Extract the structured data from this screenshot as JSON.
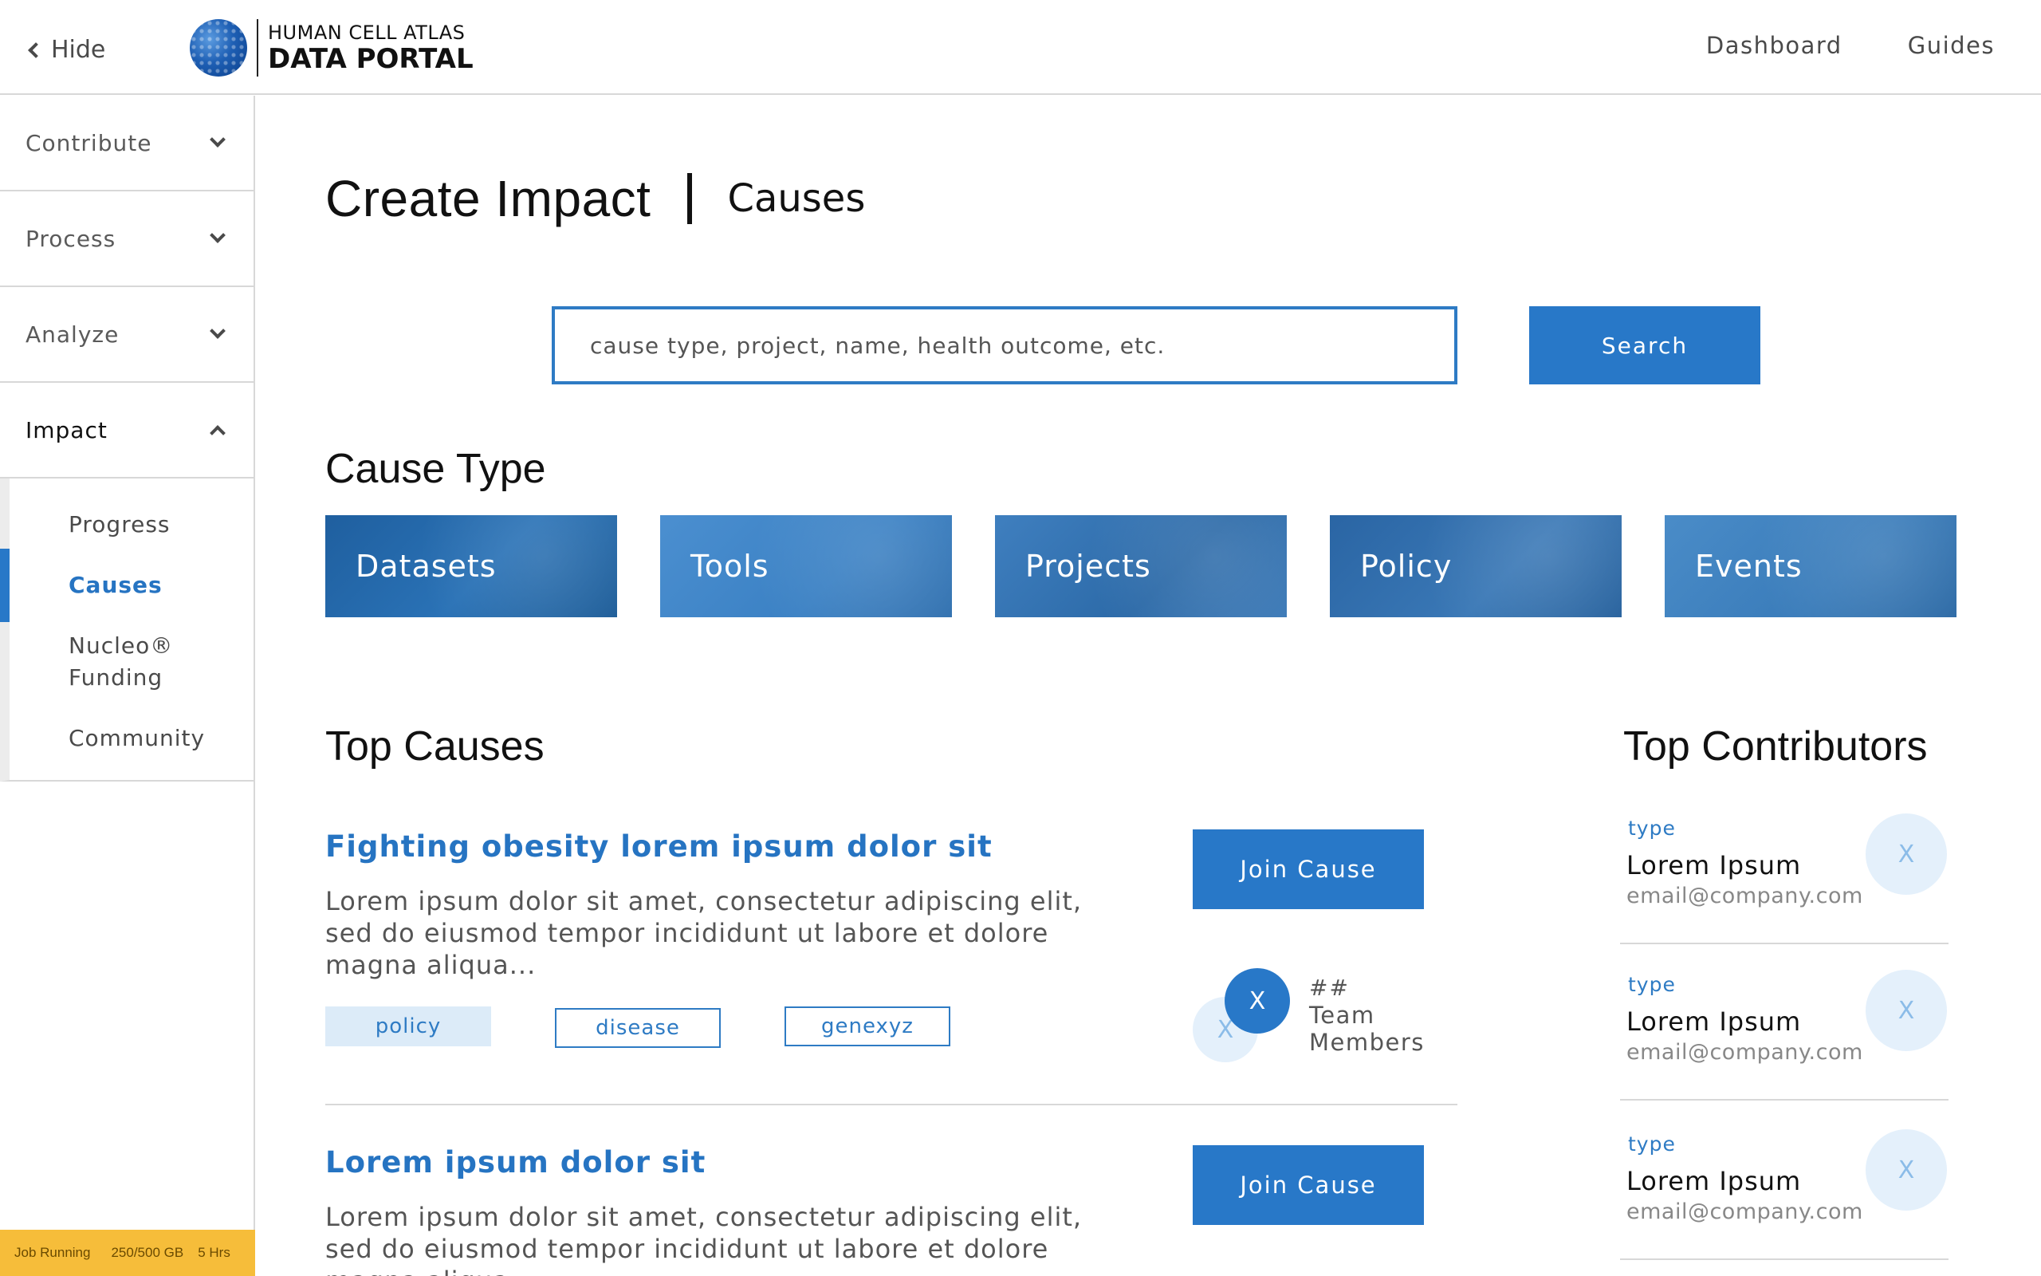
{
  "header": {
    "hide_label": "Hide",
    "logo_line1": "HUMAN CELL ATLAS",
    "logo_line2": "DATA PORTAL",
    "nav": [
      "Dashboard",
      "Guides"
    ]
  },
  "sidebar": {
    "items": [
      {
        "label": "Contribute",
        "state": "collapsed"
      },
      {
        "label": "Process",
        "state": "collapsed"
      },
      {
        "label": "Analyze",
        "state": "collapsed"
      },
      {
        "label": "Impact",
        "state": "expanded"
      }
    ],
    "subitems": [
      "Progress",
      "Causes",
      "Nucleo® Funding",
      "Community"
    ],
    "active_subitem": "Causes",
    "status": {
      "label": "Job Running",
      "storage": "250/500 GB",
      "time": "5 Hrs"
    }
  },
  "page": {
    "title": "Create Impact",
    "subtitle": "Causes"
  },
  "search": {
    "placeholder": "cause type, project, name, health outcome, etc.",
    "button": "Search"
  },
  "cause_type": {
    "heading": "Cause Type",
    "tiles": [
      "Datasets",
      "Tools",
      "Projects",
      "Policy",
      "Events"
    ]
  },
  "top_causes": {
    "heading": "Top Causes",
    "items": [
      {
        "title": "Fighting obesity lorem ipsum dolor sit",
        "description_lines": [
          "Lorem ipsum dolor sit amet, consectetur adipiscing elit,",
          "sed do eiusmod tempor incididunt ut labore et dolore",
          "magna aliqua..."
        ],
        "tags": [
          "policy",
          "disease",
          "genexyz"
        ],
        "join_label": "Join Cause",
        "avatar_initials": [
          "X",
          "X"
        ],
        "team_count": "##",
        "team_label_lines": [
          "Team",
          "Members"
        ]
      },
      {
        "title": "Lorem ipsum dolor sit",
        "description_lines": [
          "Lorem ipsum dolor sit amet, consectetur adipiscing elit,",
          "sed do eiusmod tempor incididunt ut labore et dolore",
          "magna aliqua..."
        ],
        "join_label": "Join Cause"
      }
    ]
  },
  "top_contributors": {
    "heading": "Top Contributors",
    "items": [
      {
        "type": "type",
        "name": "Lorem Ipsum",
        "email": "email@company.com",
        "initial": "X"
      },
      {
        "type": "type",
        "name": "Lorem Ipsum",
        "email": "email@company.com",
        "initial": "X"
      },
      {
        "type": "type",
        "name": "Lorem Ipsum",
        "email": "email@company.com",
        "initial": "X"
      }
    ]
  },
  "colors": {
    "accent": "#2878c8",
    "status_bar": "#f6bd3a",
    "tag_fill": "#dcebf8"
  }
}
